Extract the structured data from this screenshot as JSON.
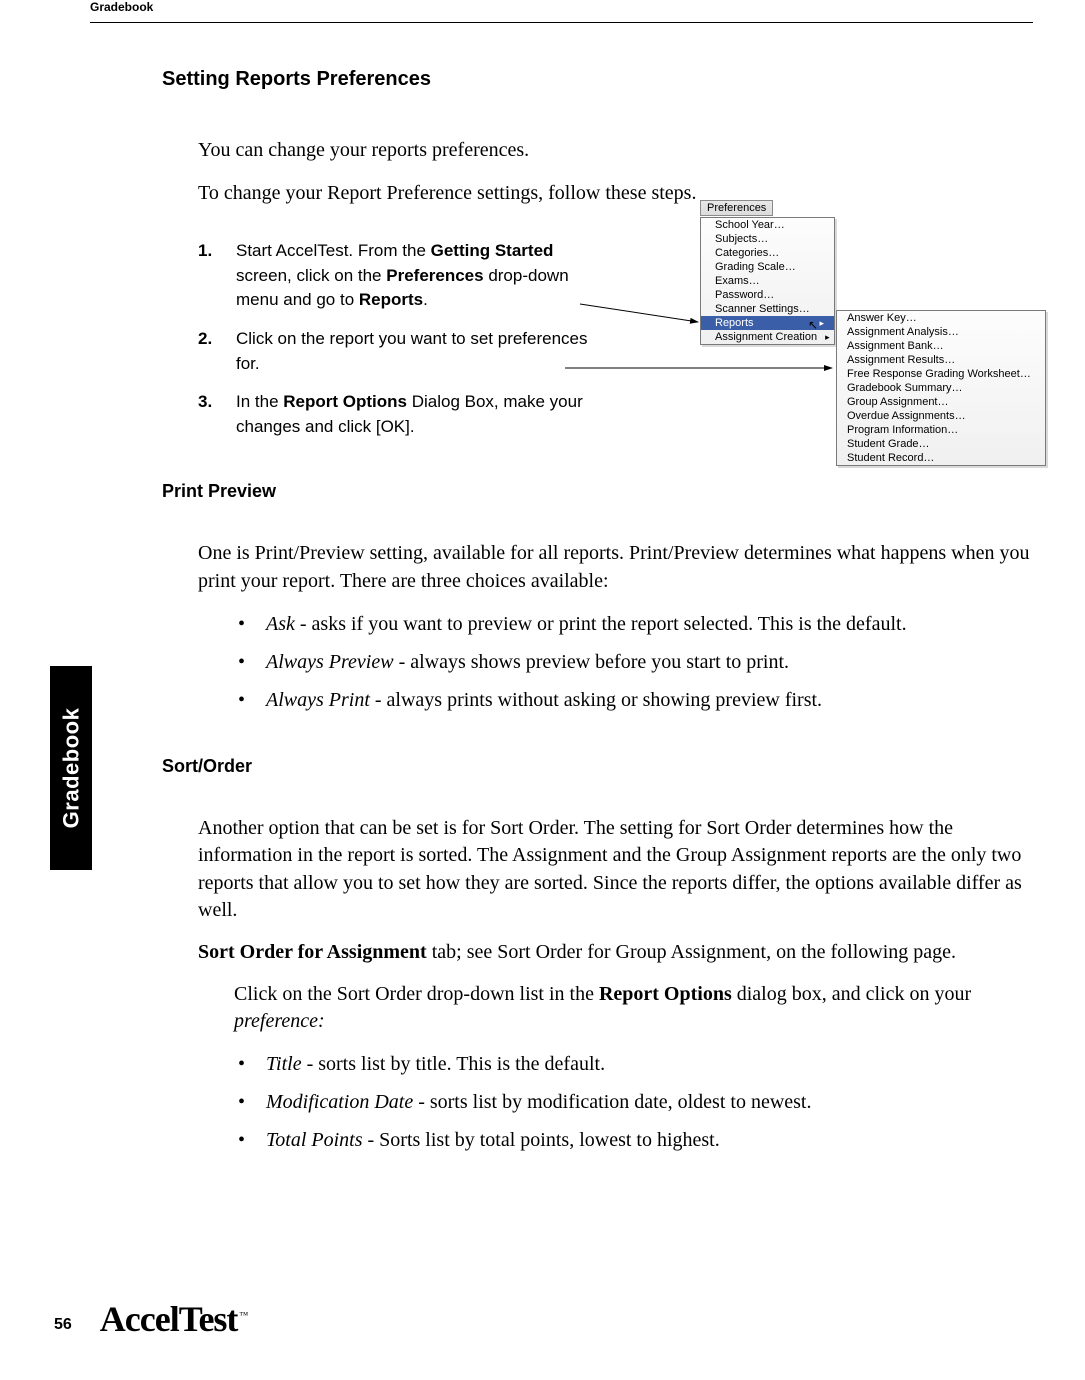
{
  "runningHead": "Gradebook",
  "pageNumber": "56",
  "brand": "AccelTest",
  "brandTm": "™",
  "sideTab": "Gradebook",
  "section1": {
    "title": "Setting Reports Preferences",
    "p1": "You can change your reports preferences.",
    "p2": "To change your Report Preference settings, follow these steps."
  },
  "steps": [
    {
      "num": "1.",
      "html": "Start AccelTest. From the <b>Getting Started</b> screen, click on the <b>Preferences</b> drop-down menu and go to <b>Reports</b>."
    },
    {
      "num": "2.",
      "html": "Click on the report you want to set preferences for."
    },
    {
      "num": "3.",
      "html": "In the <b>Report Options</b> Dialog Box, make your changes and click [OK]."
    }
  ],
  "menu": {
    "title": "Preferences",
    "items": [
      "School Year…",
      "Subjects…",
      "Categories…",
      "Grading Scale…",
      "Exams…",
      "Password…",
      "Scanner Settings…"
    ],
    "hiItem": "Reports",
    "lastItem": "Assignment Creation",
    "sub": [
      "Answer Key…",
      "Assignment Analysis…",
      "Assignment Bank…",
      "Assignment Results…",
      "Free Response Grading Worksheet…",
      "Gradebook Summary…",
      "Group Assignment…",
      "Overdue Assignments…",
      "Program Information…",
      "Student Grade…",
      "Student Record…"
    ]
  },
  "printPreview": {
    "title": "Print Preview",
    "p": "One is Print/Preview setting, available for all reports. Print/Preview determines what happens when you print your report. There are three choices available:",
    "bullets": [
      {
        "em": "Ask",
        "rest": " - asks if you want to preview or print the report selected. This is the default."
      },
      {
        "em": "Always Preview",
        "rest": " - always shows preview before you start to print."
      },
      {
        "em": "Always Print",
        "rest": " - always prints without asking or showing preview first."
      }
    ]
  },
  "sortOrder": {
    "title": "Sort/Order",
    "p1": "Another option that can be set is for Sort Order. The setting for Sort Order determines how the information in the report is sorted. The Assignment and the Group Assignment reports are the only two reports that allow you to set how they are sorted. Since the reports differ, the options available differ as well.",
    "p2a": "Sort Order for Assignment",
    "p2b": " tab; see Sort Order for Group Assignment, on the following page.",
    "p3a": "Click on the Sort Order drop-down list in the ",
    "p3b": "Report Options",
    "p3c": " dialog box, and click on your ",
    "p3d": "preference:",
    "bullets": [
      {
        "em": "Title",
        "rest": " - sorts list by title. This is the default."
      },
      {
        "em": "Modification Date",
        "rest": " - sorts list by modification date, oldest to newest."
      },
      {
        "em": "Total Points",
        "rest": " - Sorts list by total points, lowest to highest."
      }
    ]
  }
}
